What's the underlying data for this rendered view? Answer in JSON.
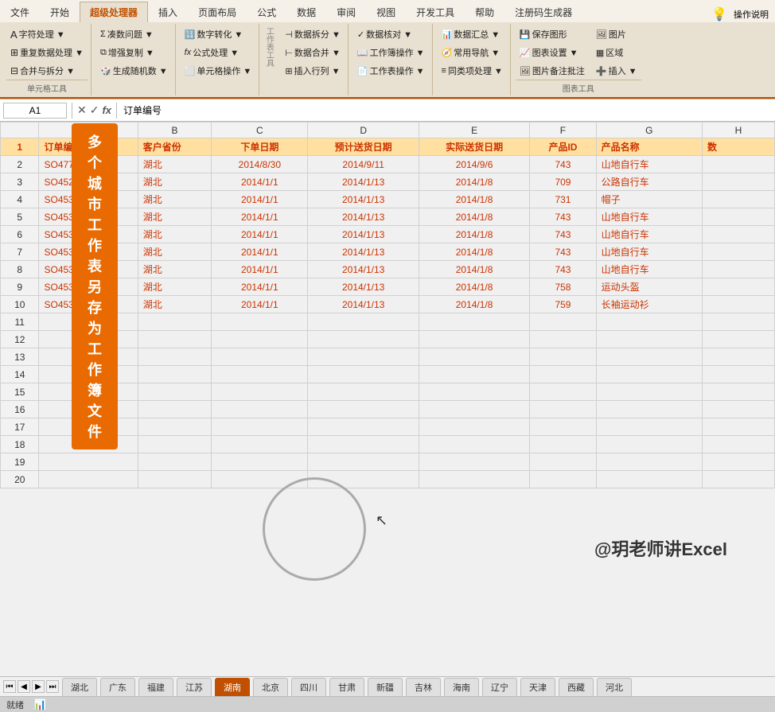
{
  "app": {
    "title": "超级处理器",
    "titleBar": {
      "buttons": [
        "文件",
        "开始",
        "超级处理器",
        "插入",
        "页面布局",
        "公式",
        "数据",
        "审阅",
        "视图",
        "开发工具",
        "帮助",
        "注册码生成器",
        "操作说明"
      ]
    }
  },
  "ribbon": {
    "activeTab": "超级处理器",
    "tabs": [
      "文件",
      "开始",
      "超级处理器",
      "插入",
      "页面布局",
      "公式",
      "数据",
      "审阅",
      "视图",
      "开发工具",
      "帮助",
      "注册码生成器"
    ],
    "rightButtons": [
      "💡",
      "操作说明"
    ],
    "groups": {
      "cellTools": {
        "label": "单元格工具",
        "buttons": [
          "字符处理▼",
          "凑数问题▼",
          "数字转化▼",
          "重复数据处理▼",
          "增强复制▼",
          "公式处理▼",
          "合并与拆分▼",
          "生成随机数▼",
          "单元格操作▼"
        ]
      },
      "workbookTools": {
        "label": "工作表工具",
        "buttons": [
          "数据拆分▼",
          "数据核对▼",
          "数据汇总▼",
          "数据合并▼",
          "工作簿操作▼",
          "常用导航▼",
          "插入行列▼",
          "工作表操作▼",
          "同类项处理▼"
        ]
      },
      "chartTools": {
        "label": "图表工具",
        "buttons": [
          "保存图形",
          "图表设置▼",
          "图片备注批注",
          "图片",
          "区域",
          "插入▼"
        ]
      }
    }
  },
  "formulaBar": {
    "nameBox": "A1",
    "formula": "订单编号"
  },
  "sheet": {
    "headers": [
      "A",
      "B",
      "C",
      "D",
      "E",
      "F",
      "G",
      "H"
    ],
    "columnHeaders": [
      "订单编号",
      "客户省份",
      "下单日期",
      "预计送货日期",
      "实际送货日期",
      "产品ID",
      "产品名称",
      "数"
    ],
    "rows": [
      [
        "SO47701",
        "湖北",
        "2014/8/30",
        "2014/9/11",
        "2014/9/6",
        "743",
        "山地自行车",
        ""
      ],
      [
        "SO45287",
        "湖北",
        "2014/1/1",
        "2014/1/13",
        "2014/1/8",
        "709",
        "公路自行车",
        ""
      ],
      [
        "SO45334",
        "湖北",
        "2014/1/1",
        "2014/1/13",
        "2014/1/8",
        "731",
        "帽子",
        ""
      ],
      [
        "SO45334",
        "湖北",
        "2014/1/1",
        "2014/1/13",
        "2014/1/8",
        "743",
        "山地自行车",
        ""
      ],
      [
        "SO45334",
        "湖北",
        "2014/1/1",
        "2014/1/13",
        "2014/1/8",
        "743",
        "山地自行车",
        ""
      ],
      [
        "SO45334",
        "湖北",
        "2014/1/1",
        "2014/1/13",
        "2014/1/8",
        "743",
        "山地自行车",
        ""
      ],
      [
        "SO45334",
        "湖北",
        "2014/1/1",
        "2014/1/13",
        "2014/1/8",
        "743",
        "山地自行车",
        ""
      ],
      [
        "SO45334",
        "湖北",
        "2014/1/1",
        "2014/1/13",
        "2014/1/8",
        "758",
        "运动头盔",
        ""
      ],
      [
        "SO45334",
        "湖北",
        "2014/1/1",
        "2014/1/13",
        "2014/1/8",
        "759",
        "长袖运动衫",
        ""
      ]
    ],
    "emptyRows": [
      11,
      12,
      13,
      14,
      15,
      16,
      17,
      18,
      19,
      20
    ]
  },
  "banner": {
    "text": "多个城市工作表另存为工作簿文件",
    "cursor": "↖"
  },
  "watermark": "@玥老师讲Excel",
  "tabs": {
    "sheets": [
      "湖北",
      "广东",
      "福建",
      "江苏",
      "湖南",
      "北京",
      "四川",
      "甘肃",
      "新疆",
      "吉林",
      "海南",
      "辽宁",
      "天津",
      "西藏",
      "河北"
    ],
    "activeSheet": "湖南"
  },
  "statusBar": {
    "text": "就绪",
    "icon": "📊"
  }
}
